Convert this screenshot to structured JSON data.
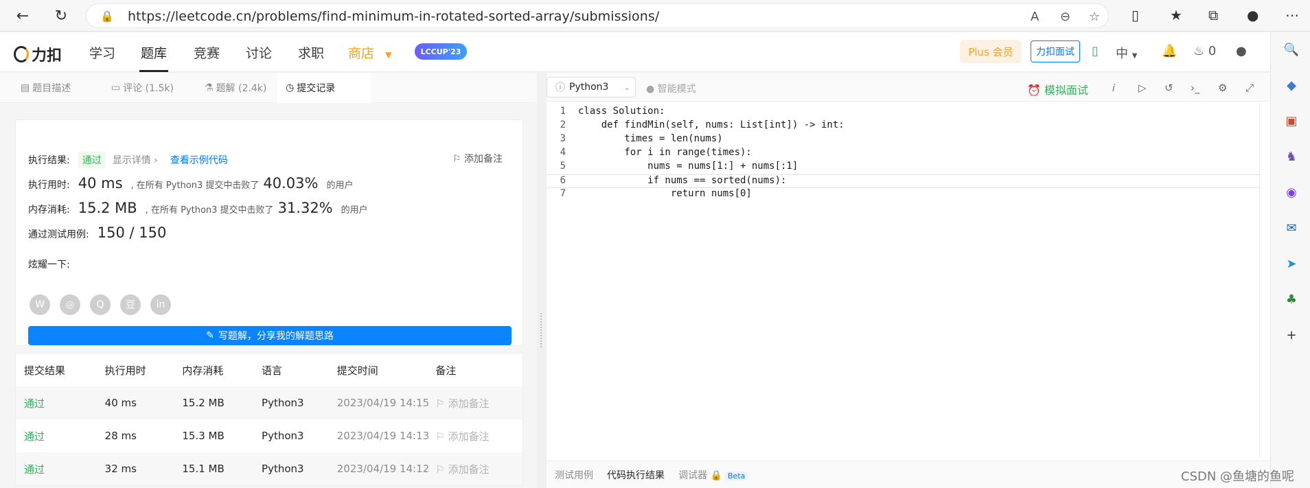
{
  "browser": {
    "url": "https://leetcode.cn/problems/find-minimum-in-rotated-sorted-array/submissions/"
  },
  "header": {
    "logo_text": "力扣",
    "nav": [
      "学习",
      "题库",
      "竞赛",
      "讨论",
      "求职",
      "商店"
    ],
    "lccup": "LCCUP'23",
    "plus": "Plus 会员",
    "interview": "力扣面试",
    "lang_switch": "中",
    "points": "0"
  },
  "tabs": [
    "题目描述",
    "评论 (1.5k)",
    "题解 (2.4k)",
    "提交记录"
  ],
  "result": {
    "label": "执行结果:",
    "status": "通过",
    "detail": "显示详情 ›",
    "sample": "查看示例代码",
    "add_note": "添加备注",
    "time_label": "执行用时:",
    "time_value": "40 ms",
    "time_mid": ", 在所有 Python3 提交中击败了",
    "time_pct": "40.03%",
    "users": "的用户",
    "mem_label": "内存消耗:",
    "mem_value": "15.2 MB",
    "mem_mid": ", 在所有 Python3 提交中击败了",
    "mem_pct": "31.32%",
    "tests_label": "通过测试用例:",
    "tests_value": "150 / 150",
    "share_label": "炫耀一下:",
    "write_btn": "写题解，分享我的解题思路"
  },
  "table": {
    "headers": [
      "提交结果",
      "执行用时",
      "内存消耗",
      "语言",
      "提交时间",
      "备注"
    ],
    "rows": [
      [
        "通过",
        "40 ms",
        "15.2 MB",
        "Python3",
        "2023/04/19 14:15",
        "添加备注"
      ],
      [
        "通过",
        "28 ms",
        "15.3 MB",
        "Python3",
        "2023/04/19 14:13",
        "添加备注"
      ],
      [
        "通过",
        "32 ms",
        "15.1 MB",
        "Python3",
        "2023/04/19 14:12",
        "添加备注"
      ]
    ]
  },
  "editor": {
    "language": "Python3",
    "smart_mode": "智能模式",
    "mock_interview": "模拟面试",
    "lines": [
      "class Solution:",
      "    def findMin(self, nums: List[int]) -> int:",
      "        times = len(nums)",
      "        for i in range(times):",
      "            nums = nums[1:] + nums[:1]",
      "            if nums == sorted(nums):",
      "                return nums[0]"
    ],
    "bottom_tabs": [
      "测试用例",
      "代码执行结果",
      "调试器"
    ],
    "beta": "Beta"
  },
  "watermark": "CSDN @鱼塘的鱼呢"
}
